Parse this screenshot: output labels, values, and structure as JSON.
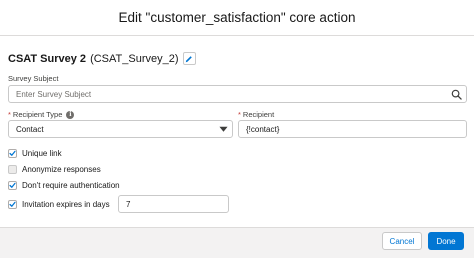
{
  "modal": {
    "title": "Edit \"customer_satisfaction\" core action"
  },
  "survey": {
    "name": "CSAT Survey 2",
    "api_name": "(CSAT_Survey_2)"
  },
  "fields": {
    "subject": {
      "label": "Survey Subject",
      "placeholder": "Enter Survey Subject",
      "value": ""
    },
    "recipient_type": {
      "label": "Recipient Type",
      "required": true,
      "value": "Contact",
      "icon": "info-icon"
    },
    "recipient": {
      "label": "Recipient",
      "required": true,
      "value": "{!contact}"
    },
    "expiry_days": {
      "value": "7"
    }
  },
  "options": [
    {
      "label": "Unique link",
      "checked": true,
      "disabled": false
    },
    {
      "label": "Anonymize responses",
      "checked": false,
      "disabled": true
    },
    {
      "label": "Don't require authentication",
      "checked": true,
      "disabled": false
    },
    {
      "label": "Invitation expires in days",
      "checked": true,
      "disabled": false
    }
  ],
  "footer": {
    "cancel_label": "Cancel",
    "done_label": "Done"
  },
  "colors": {
    "brand": "#0176d3",
    "required": "#c23934",
    "border": "#c9c9c9"
  }
}
